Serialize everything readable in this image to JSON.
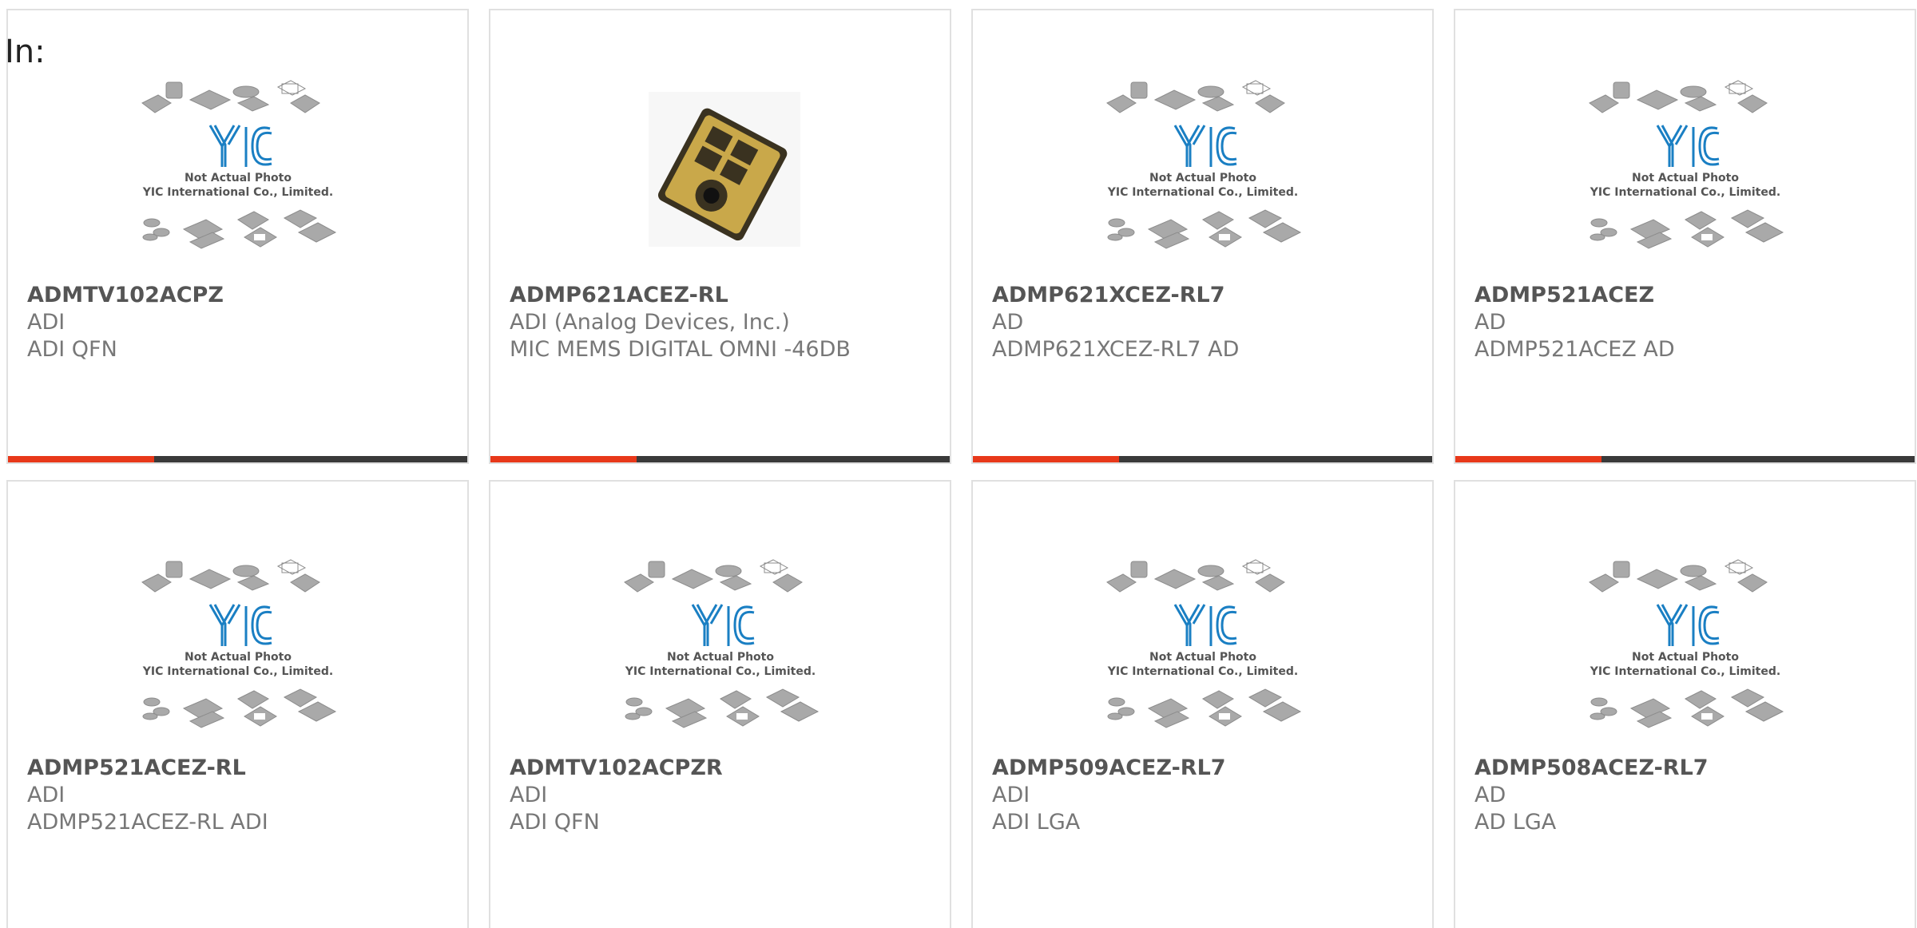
{
  "heading": "In:",
  "colors": {
    "accent": "#e8381a",
    "bar": "#3a3a3a",
    "logo_blue": "#1a7fc3"
  },
  "placeholder": {
    "line1": "Not Actual Photo",
    "line2": "YIC International Co., Limited."
  },
  "products": [
    {
      "part_number": "ADMTV102ACPZ",
      "manufacturer": "ADI",
      "description": "ADI QFN",
      "image": "placeholder",
      "has_bar": true
    },
    {
      "part_number": "ADMP621ACEZ-RL",
      "manufacturer": "ADI (Analog Devices, Inc.)",
      "description": "MIC MEMS DIGITAL OMNI -46DB",
      "image": "photo",
      "has_bar": true
    },
    {
      "part_number": "ADMP621XCEZ-RL7",
      "manufacturer": "AD",
      "description": "ADMP621XCEZ-RL7 AD",
      "image": "placeholder",
      "has_bar": true
    },
    {
      "part_number": "ADMP521ACEZ",
      "manufacturer": "AD",
      "description": "ADMP521ACEZ AD",
      "image": "placeholder",
      "has_bar": true
    },
    {
      "part_number": "ADMP521ACEZ-RL",
      "manufacturer": "ADI",
      "description": "ADMP521ACEZ-RL ADI",
      "image": "placeholder",
      "has_bar": false
    },
    {
      "part_number": "ADMTV102ACPZR",
      "manufacturer": "ADI",
      "description": "ADI QFN",
      "image": "placeholder",
      "has_bar": false
    },
    {
      "part_number": "ADMP509ACEZ-RL7",
      "manufacturer": "ADI",
      "description": "ADI LGA",
      "image": "placeholder",
      "has_bar": false
    },
    {
      "part_number": "ADMP508ACEZ-RL7",
      "manufacturer": "AD",
      "description": "AD LGA",
      "image": "placeholder",
      "has_bar": false
    }
  ]
}
